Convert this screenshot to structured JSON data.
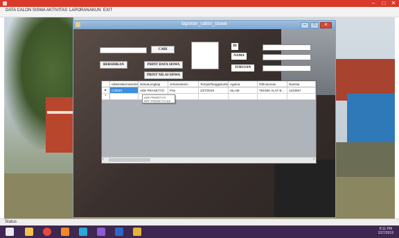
{
  "menubar": {
    "items": [
      "DATA CALON SISWA",
      "AKTIVITAS",
      "LAPORAN",
      "AKUN",
      "EXIT"
    ]
  },
  "child_window": {
    "title": "laporan_calon_siswa",
    "buttons": {
      "cari": "CARI",
      "bersihkan": "BERSIHKAN",
      "print_data_siswa": "PRINT DATA SISWA",
      "print_nilai_siswa": "PRINT NILAI SISWA"
    },
    "labels": {
      "id": "ID",
      "nama": "NAMA",
      "jurusan": "JURUSAN"
    },
    "search_value": "",
    "id_value": "",
    "nama_value": "",
    "jurusan_value": ""
  },
  "grid": {
    "columns": [
      "IdIdentitasCalonSis",
      "NamaLengkap",
      "JenisKelamin",
      "TempatTanggalLahir",
      "Agama",
      "PilihJurusan",
      "NamNa"
    ],
    "rows": [
      {
        "marker": "▸",
        "cells": [
          "C30001",
          "ADE PRASETYO",
          "Pria",
          "2/27/2019",
          "ISLAM",
          "TEKNIK ALAT B...",
          "1234567"
        ]
      },
      {
        "marker": "*",
        "cells": [
          "",
          "",
          "",
          "",
          "",
          "",
          ""
        ]
      }
    ],
    "dropdown_items": [
      "ADE PRASETYO",
      "AFIF PRASETYO AJI"
    ]
  },
  "statusbar": {
    "text": "Status"
  },
  "taskbar": {
    "time": "8:11 PM",
    "date": "2/27/2019"
  },
  "colors": {
    "titlebar": "#d9392a",
    "taskbar": "#3e2750",
    "selection": "#3d8fe0"
  }
}
